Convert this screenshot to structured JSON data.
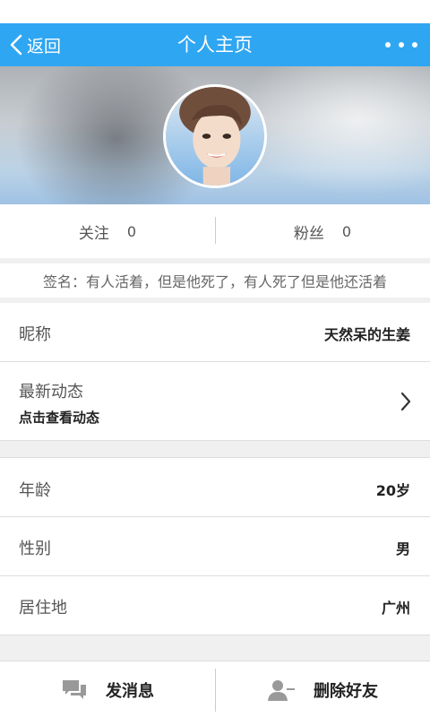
{
  "nav": {
    "back_label": "返回",
    "title": "个人主页",
    "accent_color": "#2fa6f2"
  },
  "stats": {
    "following_label": "关注",
    "following_count": "0",
    "fans_label": "粉丝",
    "fans_count": "0"
  },
  "signature": "签名：有人活着，但是他死了，有人死了但是他还活着",
  "profile": {
    "nickname_label": "昵称",
    "nickname_value": "天然呆的生姜",
    "moments_label": "最新动态",
    "moments_sub": "点击查看动态",
    "age_label": "年龄",
    "age_value": "20岁",
    "gender_label": "性别",
    "gender_value": "男",
    "location_label": "居住地",
    "location_value": "广州"
  },
  "actions": {
    "message_label": "发消息",
    "message_icon": "chat-bubbles-icon",
    "delete_label": "删除好友",
    "delete_icon": "remove-user-icon"
  }
}
